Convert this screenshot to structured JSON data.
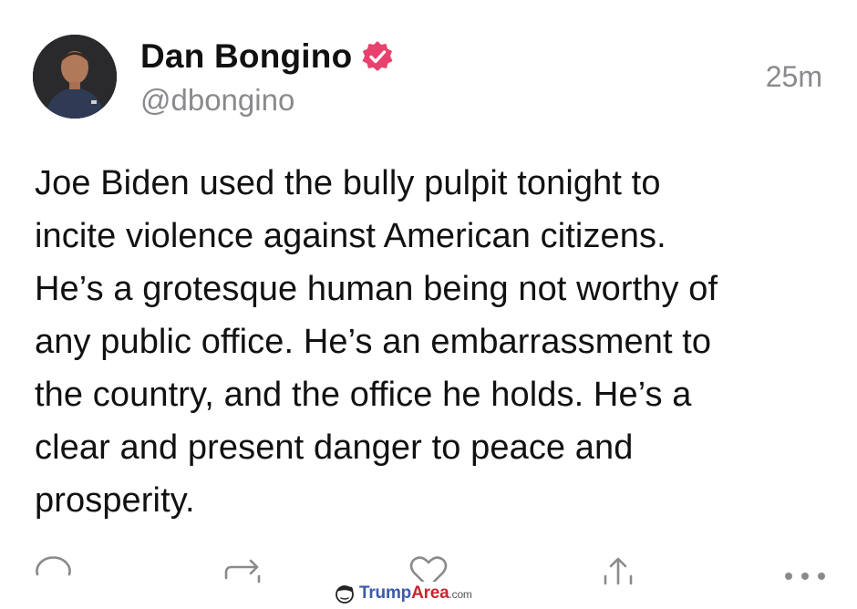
{
  "post": {
    "author": {
      "display_name": "Dan Bongino",
      "handle": "@dbongino",
      "verified_color": "#e8416d"
    },
    "timestamp": "25m",
    "body": "Joe Biden used the bully pulpit tonight to\nincite violence against American citizens.\nHe’s a grotesque human being not worthy of\nany public office. He’s an embarrassment to\nthe country, and the office he holds. He’s a\nclear and present danger to peace and\nprosperity.",
    "actions": [
      {
        "name": "reply",
        "icon": "reply-icon"
      },
      {
        "name": "repost",
        "icon": "repost-icon"
      },
      {
        "name": "like",
        "icon": "heart-icon"
      },
      {
        "name": "share",
        "icon": "share-icon"
      },
      {
        "name": "more",
        "icon": "more-icon"
      }
    ]
  },
  "watermark": {
    "part1": "Trump",
    "part2": "Area",
    "tld": ".com"
  },
  "colors": {
    "text": "#111111",
    "secondary_text": "#8a8a8e",
    "icon": "#8a8a8e",
    "verified": "#e8416d"
  }
}
